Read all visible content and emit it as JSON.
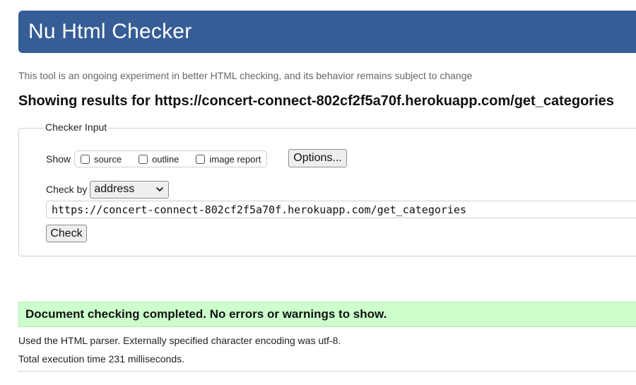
{
  "header": {
    "title": "Nu Html Checker"
  },
  "intro": {
    "text": "This tool is an ongoing experiment in better HTML checking, and its behavior remains subject to change"
  },
  "results_heading": {
    "prefix": "Showing results for",
    "url": "https://concert-connect-802cf2f5a70f.herokuapp.com/get_categories"
  },
  "checker_input": {
    "legend": "Checker Input",
    "show_label": "Show",
    "show_options": [
      {
        "label": "source",
        "checked": false
      },
      {
        "label": "outline",
        "checked": false
      },
      {
        "label": "image report",
        "checked": false
      }
    ],
    "options_button": "Options...",
    "check_by_label": "Check by",
    "check_by_selected": "address",
    "url_value": "https://concert-connect-802cf2f5a70f.herokuapp.com/get_categories",
    "check_button": "Check"
  },
  "results": {
    "success_message": "Document checking completed. No errors or warnings to show.",
    "parser_info": "Used the HTML parser. Externally specified character encoding was utf-8.",
    "execution_time": "Total execution time 231 milliseconds."
  },
  "colors": {
    "banner": "#365d96",
    "success_bg": "#ccffcc"
  }
}
